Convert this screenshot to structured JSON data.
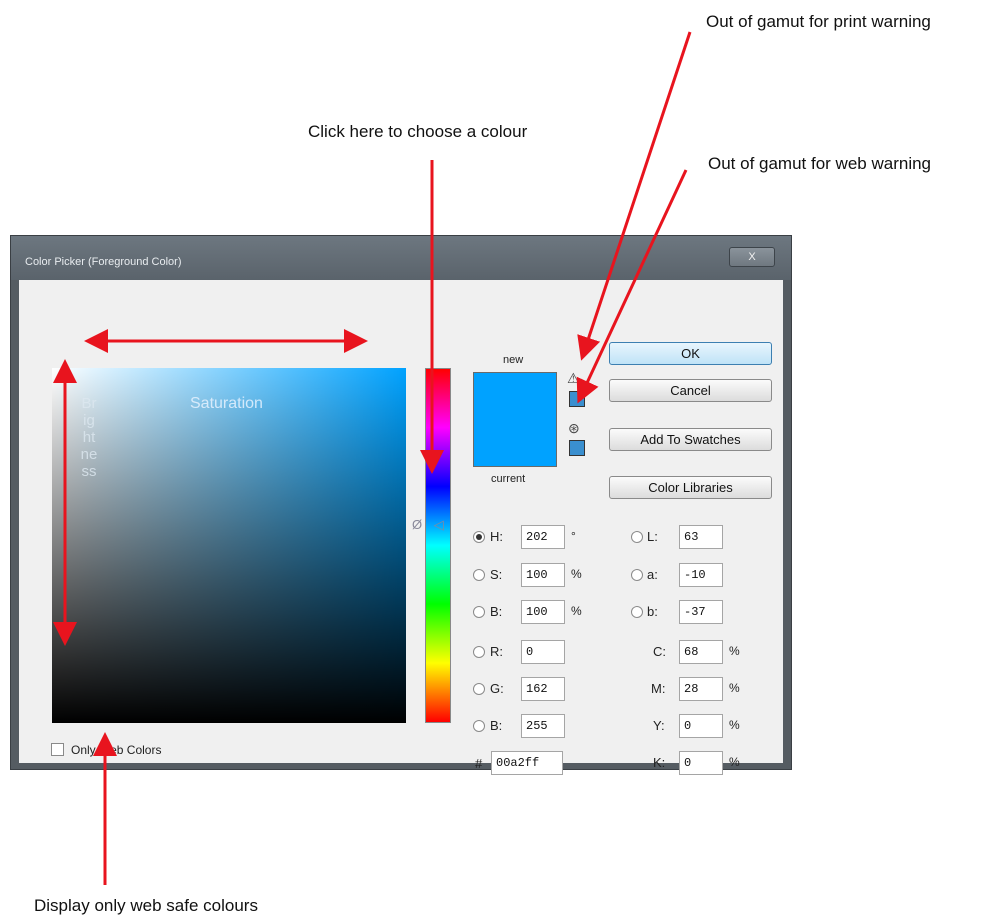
{
  "annotations": {
    "print_warning": "Out of gamut for print warning",
    "choose_colour": "Click here to choose a colour",
    "web_warning": "Out of gamut for web warning",
    "web_safe": "Display only web safe colours",
    "saturation": "Saturation",
    "brightness": "Brightness"
  },
  "window": {
    "title": "Color Picker (Foreground Color)",
    "close_label": "X"
  },
  "hue_marker_label": "Ø ◁",
  "swatch": {
    "new_label": "new",
    "current_label": "current",
    "color": "#00a2ff",
    "print_warning_icon": "warning-triangle-icon",
    "web_warning_icon": "cube-icon"
  },
  "buttons": {
    "ok": "OK",
    "cancel": "Cancel",
    "add_to_swatches": "Add To Swatches",
    "color_libraries": "Color Libraries"
  },
  "fields": {
    "H": {
      "label": "H:",
      "value": "202",
      "unit": "°"
    },
    "S": {
      "label": "S:",
      "value": "100",
      "unit": "%"
    },
    "Bv": {
      "label": "B:",
      "value": "100",
      "unit": "%"
    },
    "R": {
      "label": "R:",
      "value": "0"
    },
    "G": {
      "label": "G:",
      "value": "162"
    },
    "Bc": {
      "label": "B:",
      "value": "255"
    },
    "L": {
      "label": "L:",
      "value": "63"
    },
    "a": {
      "label": "a:",
      "value": "-10"
    },
    "b": {
      "label": "b:",
      "value": "-37"
    },
    "C": {
      "label": "C:",
      "value": "68",
      "unit": "%"
    },
    "M": {
      "label": "M:",
      "value": "28",
      "unit": "%"
    },
    "Y": {
      "label": "Y:",
      "value": "0",
      "unit": "%"
    },
    "K": {
      "label": "K:",
      "value": "0",
      "unit": "%"
    },
    "hex": {
      "label": "#",
      "value": "00a2ff"
    }
  },
  "only_web_colors": {
    "label": "Only Web Colors",
    "checked": false
  },
  "colors": {
    "arrow": "#e8141e",
    "accent": "#00a2ff"
  }
}
